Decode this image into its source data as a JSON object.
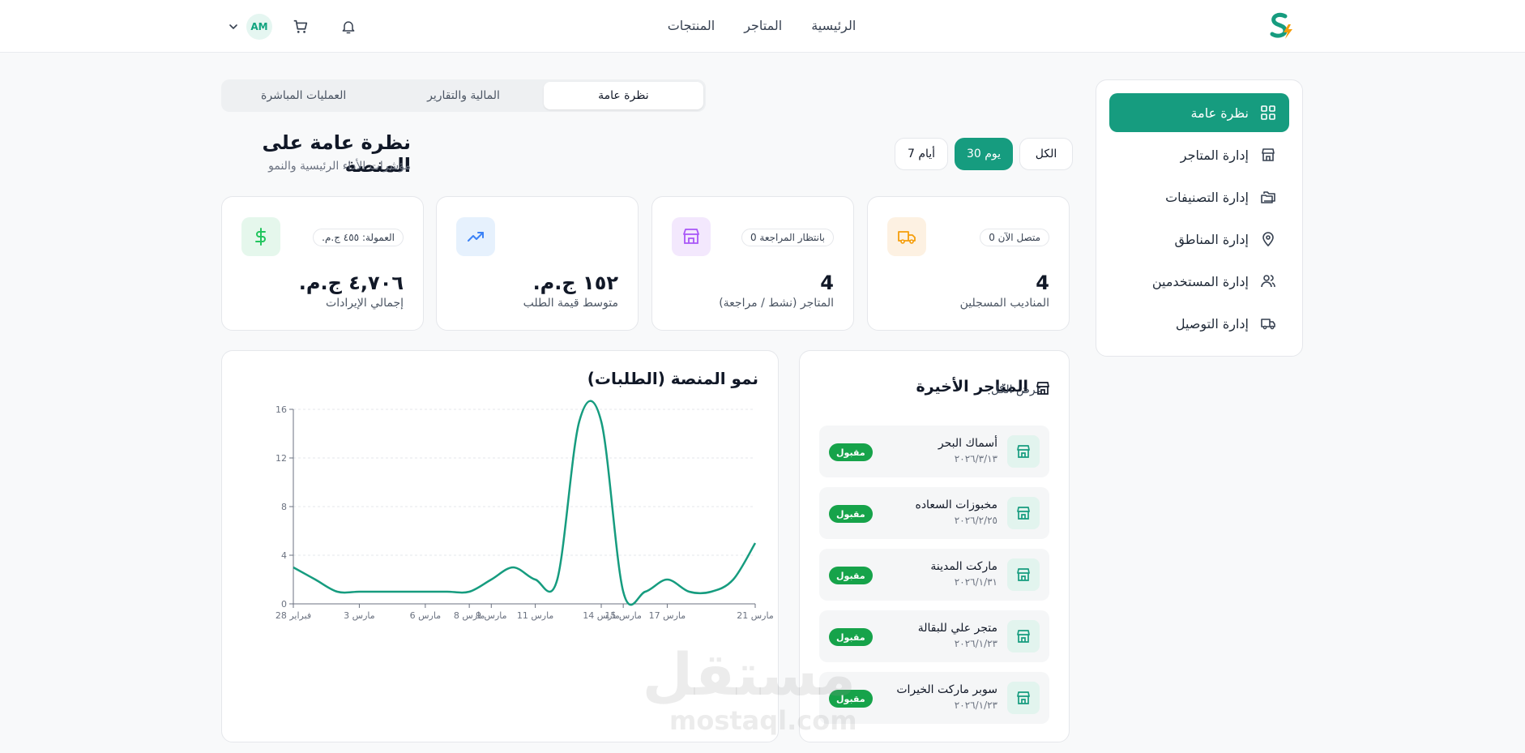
{
  "nav": {
    "links": [
      "الرئيسية",
      "المتاجر",
      "المنتجات"
    ],
    "avatar_initials": "AM"
  },
  "sidebar": {
    "items": [
      {
        "label": "نظرة عامة",
        "icon": "grid-icon",
        "active": true
      },
      {
        "label": "إدارة المتاجر",
        "icon": "store-icon",
        "active": false
      },
      {
        "label": "إدارة التصنيفات",
        "icon": "folders-icon",
        "active": false
      },
      {
        "label": "إدارة المناطق",
        "icon": "map-pin-icon",
        "active": false
      },
      {
        "label": "إدارة المستخدمين",
        "icon": "users-icon",
        "active": false
      },
      {
        "label": "إدارة التوصيل",
        "icon": "truck-icon",
        "active": false
      }
    ]
  },
  "tabs": [
    {
      "label": "نظرة عامة",
      "active": true
    },
    {
      "label": "المالية والتقارير",
      "active": false
    },
    {
      "label": "العمليات المباشرة",
      "active": false
    }
  ],
  "header": {
    "title": "نظرة عامة على المنصة",
    "subtitle": "مؤشرات الأداء الرئيسية والنمو"
  },
  "range": {
    "options": [
      {
        "label": "الكل",
        "active": false
      },
      {
        "label": "30 يوم",
        "active": true
      },
      {
        "label": "7 أيام",
        "active": false
      }
    ]
  },
  "stats": [
    {
      "value": "4",
      "label": "المناديب المسجلين",
      "pill": "متصل الآن 0",
      "icon": "truck-icon",
      "icon_bg": "#fdf1e2",
      "icon_color": "#f59e0b"
    },
    {
      "value": "4",
      "label": "المتاجر (نشط / مراجعة)",
      "pill": "بانتظار المراجعة 0",
      "icon": "store-icon",
      "icon_bg": "#f3e8fd",
      "icon_color": "#a855f7"
    },
    {
      "value": "١٥٢ ج.م.",
      "label": "متوسط قيمة الطلب",
      "pill": "",
      "icon": "trending-up-icon",
      "icon_bg": "#e6f1fd",
      "icon_color": "#3b82f6"
    },
    {
      "value": "٤,٧٠٦ ج.م.",
      "label": "إجمالي الإيرادات",
      "pill": "العمولة: ٤٥٥ ج.م.",
      "icon": "dollar-icon",
      "icon_bg": "#e5f7ec",
      "icon_color": "#22c55e"
    }
  ],
  "chart_data": {
    "type": "line",
    "title": "نمو المنصة (الطلبات)",
    "xlabel": "",
    "ylabel": "",
    "x": [
      "فبراير 28",
      "مارس 1",
      "مارس 2",
      "مارس 3",
      "مارس 4",
      "مارس 5",
      "مارس 6",
      "مارس 7",
      "مارس 8",
      "مارس 9",
      "مارس 10",
      "مارس 11",
      "مارس 12",
      "مارس 13",
      "مارس 14",
      "مارس 15",
      "مارس 16",
      "مارس 17",
      "مارس 18",
      "مارس 19",
      "مارس 20",
      "مارس 21"
    ],
    "tick_labels": [
      "فبراير 28",
      "مارس 3",
      "مارس 6",
      "مارس 8",
      "مارس 9",
      "مارس 11",
      "مارس 14",
      "مارس 15",
      "مارس 17",
      "مارس 21"
    ],
    "series": [
      {
        "values": [
          3,
          2,
          1,
          1,
          1,
          1,
          1,
          1,
          1,
          2,
          3,
          2,
          2,
          15,
          15,
          1,
          1,
          2,
          1,
          1,
          2,
          5
        ]
      }
    ],
    "ylim": [
      0,
      16
    ],
    "yticks": [
      0,
      4,
      8,
      12,
      16
    ],
    "grid": true,
    "color": "#169c7f"
  },
  "stores": {
    "title": "المتاجر الأخيرة",
    "view_all": "عرض الكل",
    "items": [
      {
        "name": "أسماك البحر",
        "date": "٢٠٢٦/٣/١٣",
        "status": "مقبول"
      },
      {
        "name": "مخبوزات السعاده",
        "date": "٢٠٢٦/٢/٢٥",
        "status": "مقبول"
      },
      {
        "name": "ماركت المدينة",
        "date": "٢٠٢٦/١/٣١",
        "status": "مقبول"
      },
      {
        "name": "متجر علي للبقالة",
        "date": "٢٠٢٦/١/٢٣",
        "status": "مقبول"
      },
      {
        "name": "سوبر ماركت الخيرات",
        "date": "٢٠٢٦/١/٢٣",
        "status": "مقبول"
      }
    ]
  },
  "watermark": {
    "ar": "مستقل",
    "en": "mostaql.com"
  },
  "colors": {
    "primary": "#169c7f",
    "success_badge": "#16a34a"
  }
}
